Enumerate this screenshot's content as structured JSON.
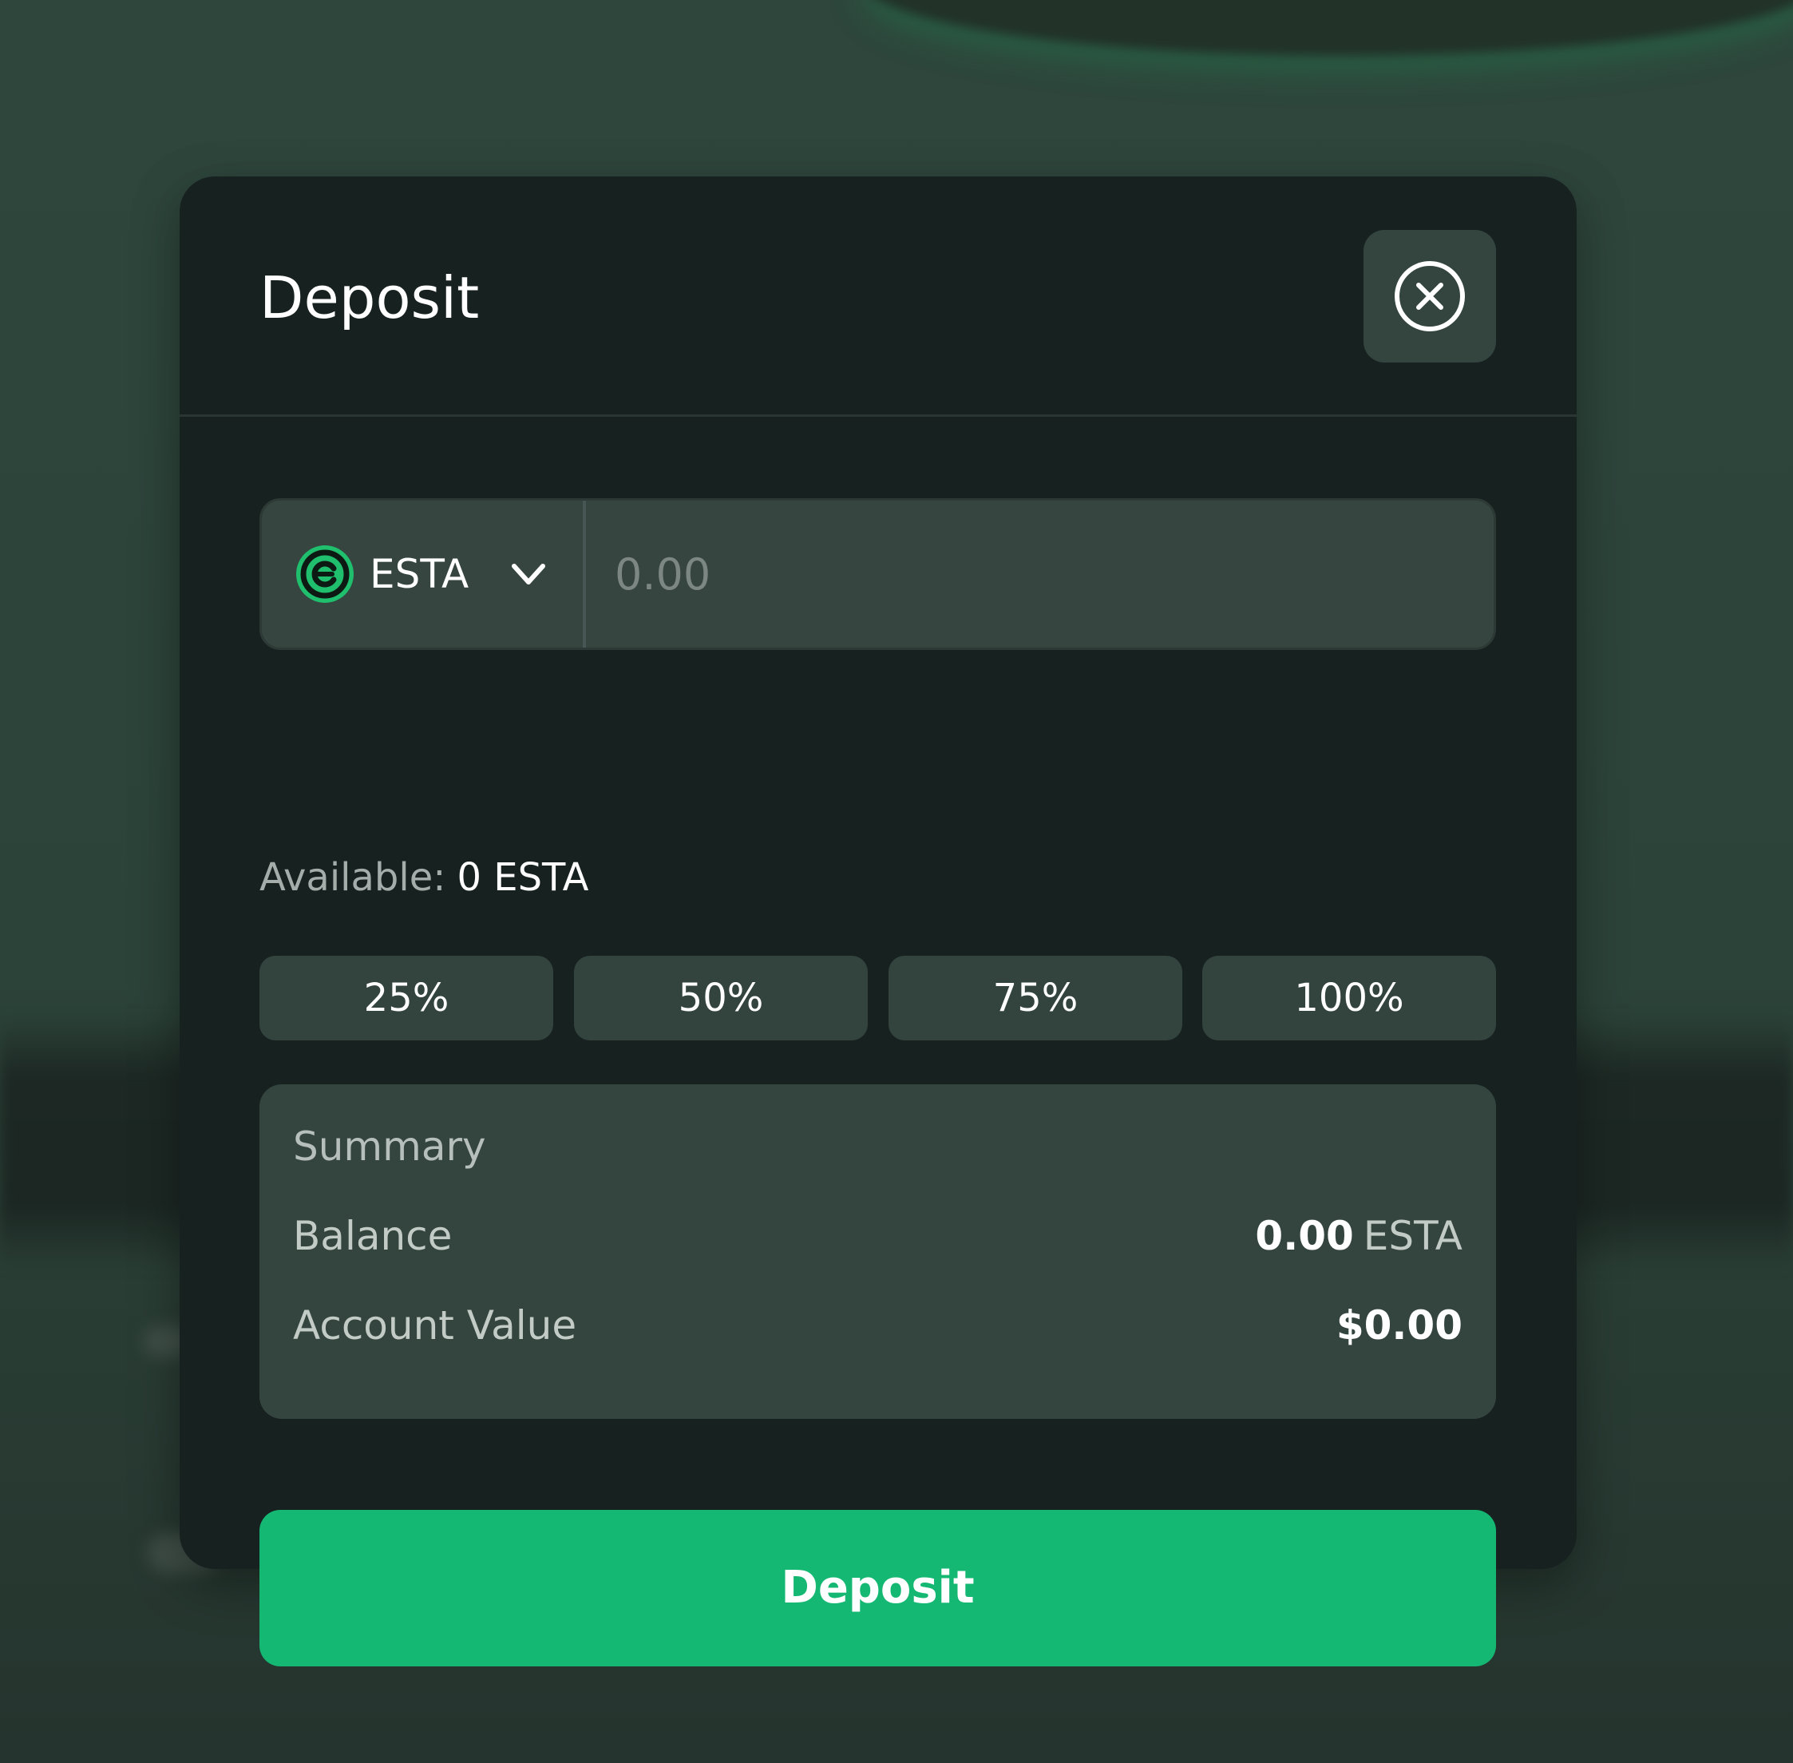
{
  "modal": {
    "title": "Deposit"
  },
  "token_select": {
    "symbol": "ESTA",
    "icon": "esta-token-logo",
    "chevron_icon": "chevron-down-icon"
  },
  "amount_input": {
    "value": "",
    "placeholder": "0.00"
  },
  "available": {
    "label": "Available:",
    "value": "0 ESTA"
  },
  "percent_buttons": [
    "25%",
    "50%",
    "75%",
    "100%"
  ],
  "summary": {
    "title": "Summary",
    "balance_label": "Balance",
    "balance_value": "0.00",
    "balance_unit": "ESTA",
    "account_value_label": "Account Value",
    "account_value": "$0.00"
  },
  "cta": {
    "label": "Deposit"
  },
  "colors": {
    "accent": "#14b873",
    "modal_bg": "#172120",
    "field_bg": "#36453f"
  },
  "close_icon": "close-circle-icon"
}
